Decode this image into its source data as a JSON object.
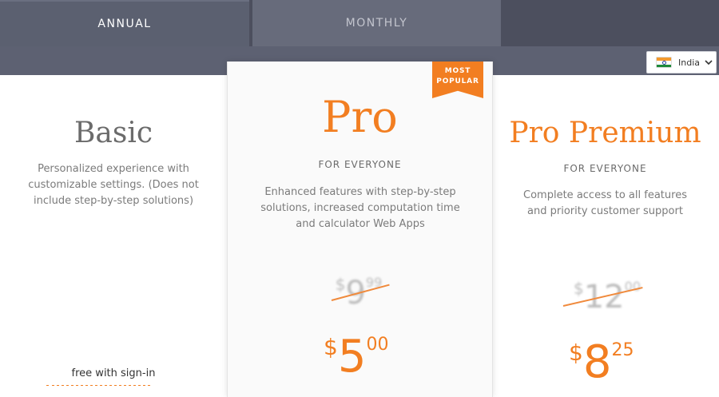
{
  "tabs": [
    {
      "label": "ANNUAL",
      "active": true
    },
    {
      "label": "MONTHLY",
      "active": false
    }
  ],
  "country": {
    "flag_icon": "india-flag-icon",
    "label": "India",
    "chevron_icon": "chevron-down-icon"
  },
  "plans": {
    "basic": {
      "name": "Basic",
      "description": "Personalized experience with customizable settings. (Does not include step-by-step solutions)",
      "free_label": "free with sign-in"
    },
    "pro": {
      "ribbon_line1": "MOST",
      "ribbon_line2": "POPULAR",
      "name": "Pro",
      "subtitle": "FOR EVERYONE",
      "description": "Enhanced features with step-by-step solutions, increased computation time and calculator Web Apps",
      "old_price": {
        "currency": "$",
        "main": "9",
        "cents": "99"
      },
      "price": {
        "currency": "$",
        "main": "5",
        "cents": "00"
      }
    },
    "premium": {
      "name": "Pro Premium",
      "subtitle": "FOR EVERYONE",
      "description": "Complete access to all features and priority customer support",
      "old_price": {
        "currency": "$",
        "main": "12",
        "cents": "00"
      },
      "price": {
        "currency": "$",
        "main": "8",
        "cents": "25"
      }
    }
  },
  "colors": {
    "accent": "#f27e21",
    "tab_bar": "#4c4f5e",
    "band": "#5d6172"
  }
}
